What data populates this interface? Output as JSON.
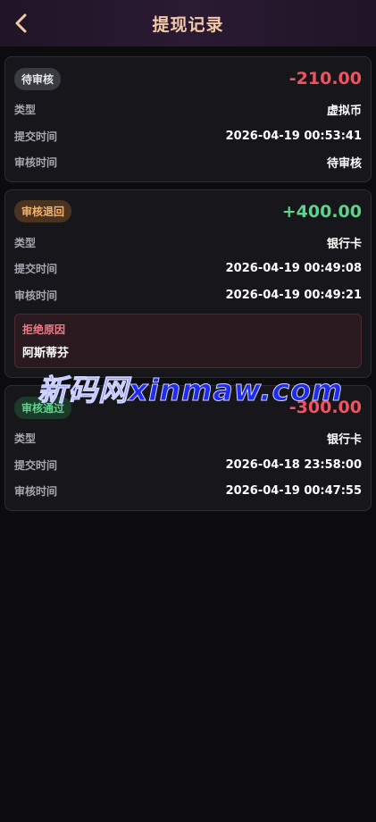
{
  "header": {
    "title": "提现记录"
  },
  "labels": {
    "type": "类型",
    "submit_time": "提交时间",
    "review_time": "审核时间",
    "reject_reason": "拒绝原因"
  },
  "records": [
    {
      "status": "待审核",
      "status_color": "#e7e7ea",
      "status_bg": "#3a3a42",
      "amount": "-210.00",
      "amount_color": "#f0525f",
      "type": "虚拟币",
      "submit_time": "2026-04-19 00:53:41",
      "review_time": "待审核"
    },
    {
      "status": "审核退回",
      "status_color": "#f6b26b",
      "status_bg": "#4a3420",
      "amount": "+400.00",
      "amount_color": "#5fd38c",
      "type": "银行卡",
      "submit_time": "2026-04-19 00:49:08",
      "review_time": "2026-04-19 00:49:21",
      "reject_reason": "阿斯蒂芬"
    },
    {
      "status": "审核通过",
      "status_color": "#5fd38c",
      "status_bg": "#1c3a2a",
      "amount": "-300.00",
      "amount_color": "#f0525f",
      "type": "银行卡",
      "submit_time": "2026-04-18 23:58:00",
      "review_time": "2026-04-19 00:47:55"
    }
  ],
  "watermark": {
    "text": "新码网xinmaw.com"
  }
}
